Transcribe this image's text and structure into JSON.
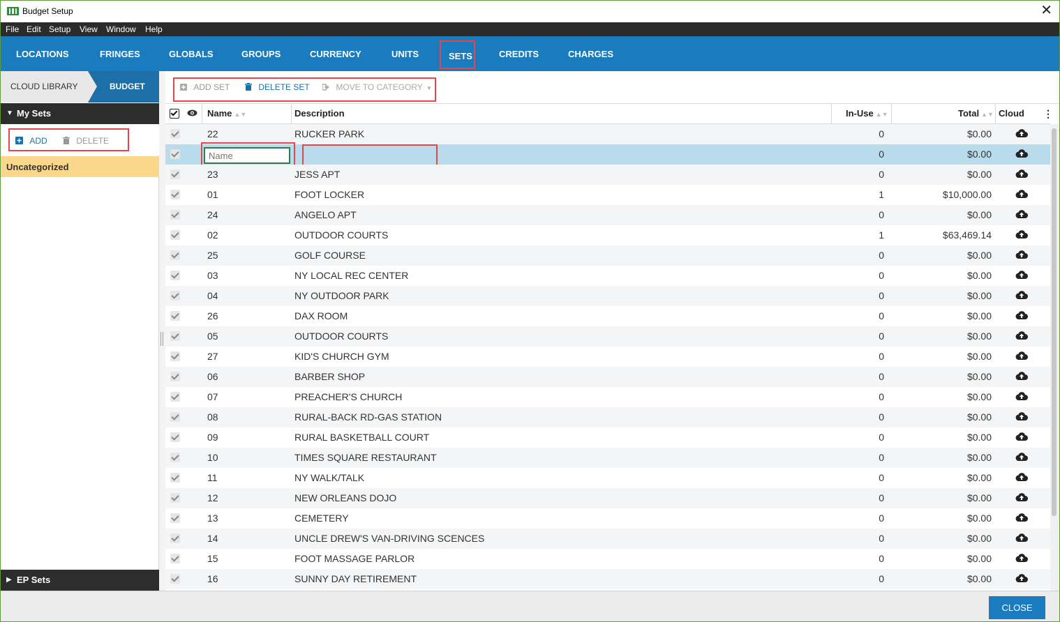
{
  "window": {
    "title": "Budget Setup",
    "close_glyph": "✕"
  },
  "menu": [
    "File",
    "Edit",
    "Setup",
    "View",
    "Window",
    "Help"
  ],
  "tabs": [
    "LOCATIONS",
    "FRINGES",
    "GLOBALS",
    "GROUPS",
    "CURRENCY",
    "UNITS",
    "SETS",
    "CREDITS",
    "CHARGES"
  ],
  "active_tab": "SETS",
  "breadcrumb": {
    "library": "CLOUD LIBRARY",
    "budget": "BUDGET"
  },
  "sidebar": {
    "my_sets_label": "My Sets",
    "add_label": "ADD",
    "delete_label": "DELETE",
    "uncategorized_label": "Uncategorized",
    "ep_sets_label": "EP Sets"
  },
  "toolbar": {
    "add_set": "ADD SET",
    "delete_set": "DELETE SET",
    "move_to_category": "MOVE TO CATEGORY"
  },
  "grid": {
    "headers": {
      "name": "Name",
      "description": "Description",
      "in_use": "In-Use",
      "total": "Total",
      "cloud": "Cloud"
    },
    "new_row_placeholder": "Name",
    "new_row": {
      "in_use": "0",
      "total": "$0.00"
    },
    "rows": [
      {
        "name": "22",
        "description": "RUCKER PARK",
        "in_use": "0",
        "total": "$0.00"
      },
      {
        "name": "23",
        "description": "JESS APT",
        "in_use": "0",
        "total": "$0.00"
      },
      {
        "name": "01",
        "description": "FOOT LOCKER",
        "in_use": "1",
        "total": "$10,000.00"
      },
      {
        "name": "24",
        "description": "ANGELO APT",
        "in_use": "0",
        "total": "$0.00"
      },
      {
        "name": "02",
        "description": "OUTDOOR COURTS",
        "in_use": "1",
        "total": "$63,469.14"
      },
      {
        "name": "25",
        "description": "GOLF COURSE",
        "in_use": "0",
        "total": "$0.00"
      },
      {
        "name": "03",
        "description": "NY LOCAL REC CENTER",
        "in_use": "0",
        "total": "$0.00"
      },
      {
        "name": "04",
        "description": "NY OUTDOOR PARK",
        "in_use": "0",
        "total": "$0.00"
      },
      {
        "name": "26",
        "description": "DAX ROOM",
        "in_use": "0",
        "total": "$0.00"
      },
      {
        "name": "05",
        "description": "OUTDOOR COURTS",
        "in_use": "0",
        "total": "$0.00"
      },
      {
        "name": "27",
        "description": "KID'S CHURCH GYM",
        "in_use": "0",
        "total": "$0.00"
      },
      {
        "name": "06",
        "description": "BARBER SHOP",
        "in_use": "0",
        "total": "$0.00"
      },
      {
        "name": "07",
        "description": "PREACHER'S CHURCH",
        "in_use": "0",
        "total": "$0.00"
      },
      {
        "name": "08",
        "description": "RURAL-BACK RD-GAS STATION",
        "in_use": "0",
        "total": "$0.00"
      },
      {
        "name": "09",
        "description": "RURAL BASKETBALL COURT",
        "in_use": "0",
        "total": "$0.00"
      },
      {
        "name": "10",
        "description": "TIMES SQUARE RESTAURANT",
        "in_use": "0",
        "total": "$0.00"
      },
      {
        "name": "11",
        "description": "NY WALK/TALK",
        "in_use": "0",
        "total": "$0.00"
      },
      {
        "name": "12",
        "description": "NEW ORLEANS DOJO",
        "in_use": "0",
        "total": "$0.00"
      },
      {
        "name": "13",
        "description": "CEMETERY",
        "in_use": "0",
        "total": "$0.00"
      },
      {
        "name": "14",
        "description": "UNCLE DREW'S VAN-DRIVING SCENCES",
        "in_use": "0",
        "total": "$0.00"
      },
      {
        "name": "15",
        "description": "FOOT MASSAGE PARLOR",
        "in_use": "0",
        "total": "$0.00"
      },
      {
        "name": "16",
        "description": "SUNNY DAY RETIREMENT",
        "in_use": "0",
        "total": "$0.00"
      }
    ]
  },
  "footer": {
    "close_label": "CLOSE"
  },
  "colors": {
    "accent": "#1a7bbf",
    "highlight": "#e2484b",
    "uncategorized": "#fbd78b",
    "selected_row": "#b8dcec"
  },
  "icons": {
    "add": "plus-square-icon",
    "delete": "trash-icon",
    "move": "move-icon",
    "cloud": "cloud-upload-icon",
    "visibility": "eye-icon"
  }
}
